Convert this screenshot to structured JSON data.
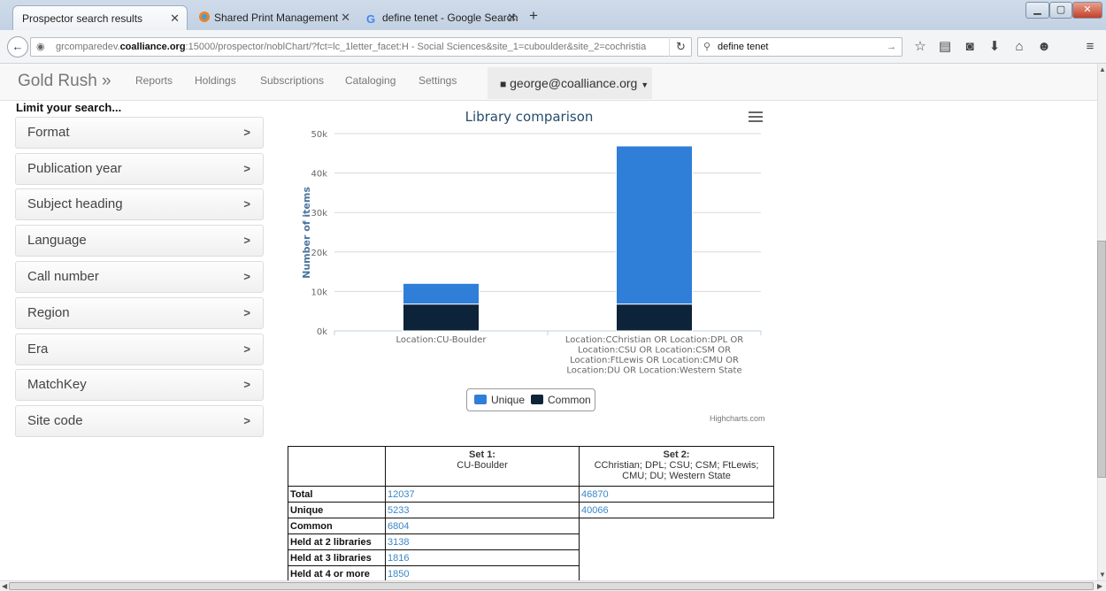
{
  "browser": {
    "tabs": [
      {
        "label": "Prospector search results",
        "active": true
      },
      {
        "label": "Shared Print Management",
        "active": false
      },
      {
        "label": "define tenet - Google Search",
        "active": false
      }
    ],
    "url_prefix": "grcomparedev.",
    "url_domain": "coalliance.org",
    "url_rest": ":15000/prospector/noblChart/?fct=lc_1letter_facet:H - Social Sciences&site_1=cuboulder&site_2=cochristia",
    "search_value": "define tenet"
  },
  "app": {
    "brand": "Gold Rush »",
    "nav": [
      "Reports",
      "Holdings",
      "Subscriptions",
      "Cataloging",
      "Settings"
    ],
    "user": "george@coalliance.org"
  },
  "sidebar": {
    "heading": "Limit your search...",
    "facets": [
      "Format",
      "Publication year",
      "Subject heading",
      "Language",
      "Call number",
      "Region",
      "Era",
      "MatchKey",
      "Site code"
    ]
  },
  "chart_data": {
    "type": "bar",
    "stacked": true,
    "title": "Library comparison",
    "ylabel": "Number of items",
    "ylim": [
      0,
      50000
    ],
    "yticks": [
      "0k",
      "10k",
      "20k",
      "30k",
      "40k",
      "50k"
    ],
    "categories": [
      [
        "Location:CU-Boulder"
      ],
      [
        "Location:CChristian OR Location:DPL OR",
        "Location:CSU OR Location:CSM OR",
        "Location:FtLewis OR Location:CMU OR",
        "Location:DU OR Location:Western State"
      ]
    ],
    "series": [
      {
        "name": "Unique",
        "color": "#2f7ed8",
        "values": [
          5233,
          40066
        ]
      },
      {
        "name": "Common",
        "color": "#0d233a",
        "values": [
          6804,
          6804
        ]
      }
    ],
    "legend": "bottom-center",
    "credit": "Highcharts.com"
  },
  "table": {
    "set1_title": "Set 1:",
    "set1_desc": "CU-Boulder",
    "set2_title": "Set 2:",
    "set2_desc": "CChristian; DPL; CSU; CSM; FtLewis; CMU; DU; Western State",
    "rows": [
      {
        "label": "Total",
        "set1": "12037",
        "set2": "46870"
      },
      {
        "label": "Unique",
        "set1": "5233",
        "set2": "40066"
      },
      {
        "label": "Common",
        "set1": "6804"
      },
      {
        "label": "Held at 2 libraries",
        "set1": "3138"
      },
      {
        "label": "Held at 3 libraries",
        "set1": "1816"
      },
      {
        "label": "Held at 4 or more",
        "set1": "1850"
      }
    ]
  }
}
